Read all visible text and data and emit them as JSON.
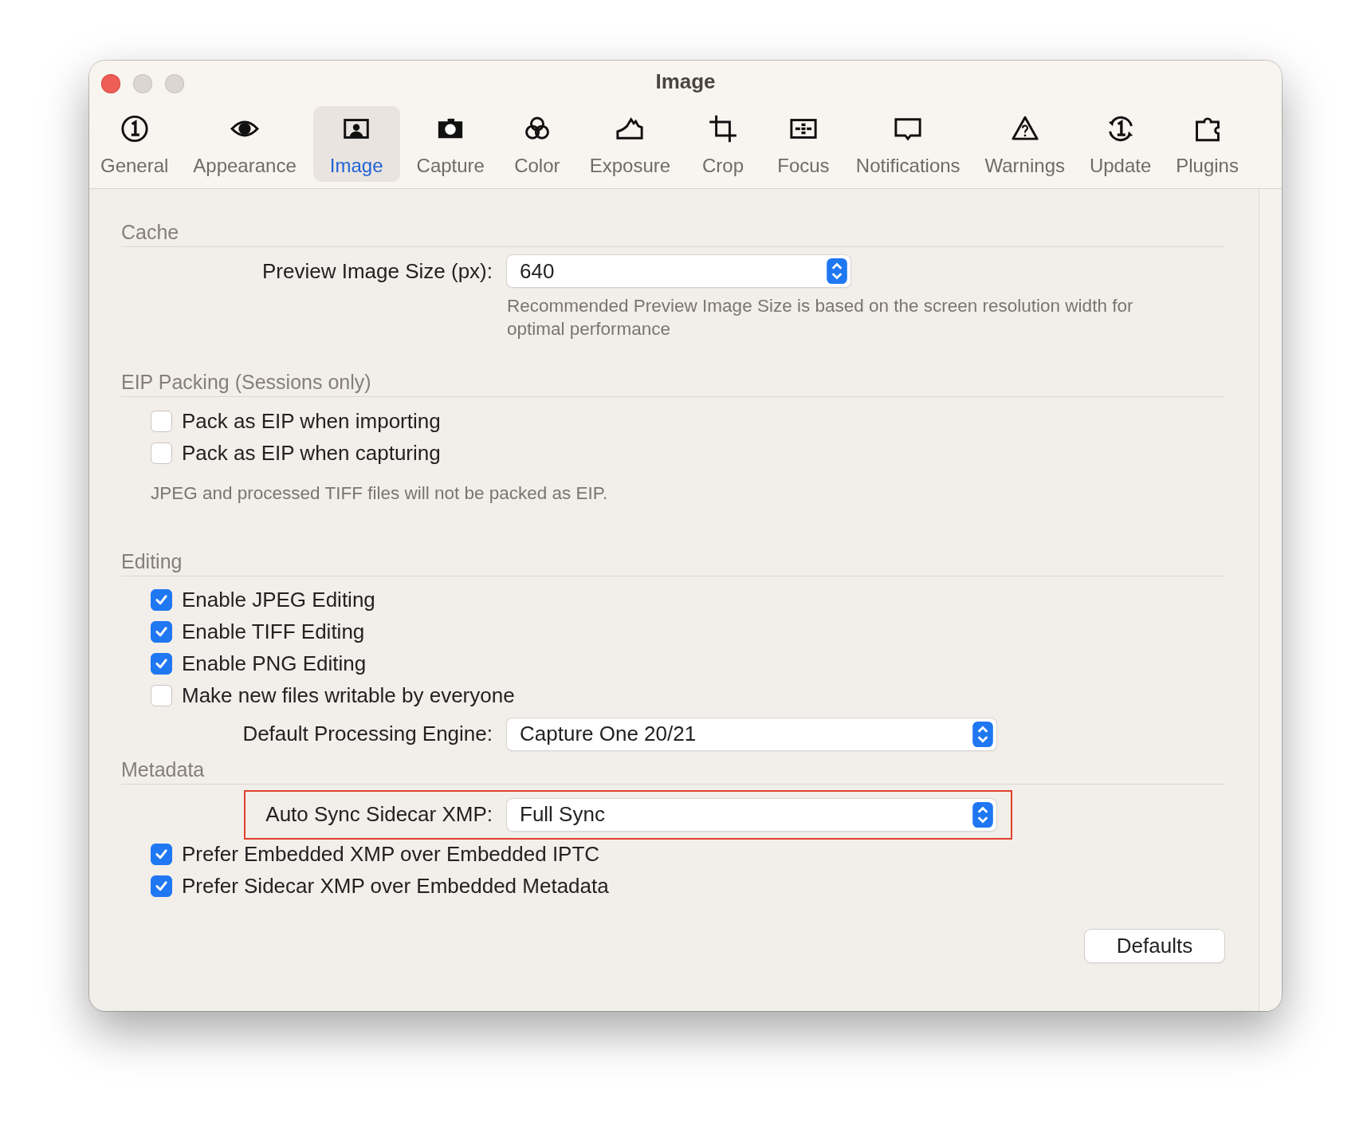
{
  "window": {
    "title": "Image"
  },
  "toolbar": [
    {
      "label": "General",
      "selected": false
    },
    {
      "label": "Appearance",
      "selected": false
    },
    {
      "label": "Image",
      "selected": true
    },
    {
      "label": "Capture",
      "selected": false
    },
    {
      "label": "Color",
      "selected": false
    },
    {
      "label": "Exposure",
      "selected": false
    },
    {
      "label": "Crop",
      "selected": false
    },
    {
      "label": "Focus",
      "selected": false
    },
    {
      "label": "Notifications",
      "selected": false
    },
    {
      "label": "Warnings",
      "selected": false
    },
    {
      "label": "Update",
      "selected": false
    },
    {
      "label": "Plugins",
      "selected": false
    }
  ],
  "sections": [
    {
      "title": "Cache",
      "items": [
        {
          "kind": "popup",
          "label": "Preview Image Size (px):",
          "value": "640",
          "highlighted": false
        },
        {
          "kind": "note",
          "text": "Recommended Preview Image Size is based on the screen resolution width for optimal performance"
        }
      ]
    },
    {
      "title": "EIP Packing (Sessions only)",
      "items": [
        {
          "kind": "checkbox",
          "label": "Pack as EIP when importing",
          "checked": false
        },
        {
          "kind": "checkbox",
          "label": "Pack as EIP when capturing",
          "checked": false
        },
        {
          "kind": "note",
          "text": "JPEG and processed TIFF files will not be packed as EIP."
        }
      ]
    },
    {
      "title": "Editing",
      "items": [
        {
          "kind": "checkbox",
          "label": "Enable JPEG Editing",
          "checked": true
        },
        {
          "kind": "checkbox",
          "label": "Enable TIFF Editing",
          "checked": true
        },
        {
          "kind": "checkbox",
          "label": "Enable PNG Editing",
          "checked": true
        },
        {
          "kind": "checkbox",
          "label": "Make new files writable by everyone",
          "checked": false
        },
        {
          "kind": "popup",
          "label": "Default Processing Engine:",
          "value": "Capture One 20/21",
          "highlighted": false
        }
      ]
    },
    {
      "title": "Metadata",
      "items": [
        {
          "kind": "popup",
          "label": "Auto Sync Sidecar XMP:",
          "value": "Full Sync",
          "highlighted": true
        },
        {
          "kind": "checkbox",
          "label": "Prefer Embedded XMP over Embedded IPTC",
          "checked": true
        },
        {
          "kind": "checkbox",
          "label": "Prefer Sidecar XMP over Embedded Metadata",
          "checked": true
        }
      ]
    }
  ],
  "buttons": [
    "Defaults"
  ]
}
